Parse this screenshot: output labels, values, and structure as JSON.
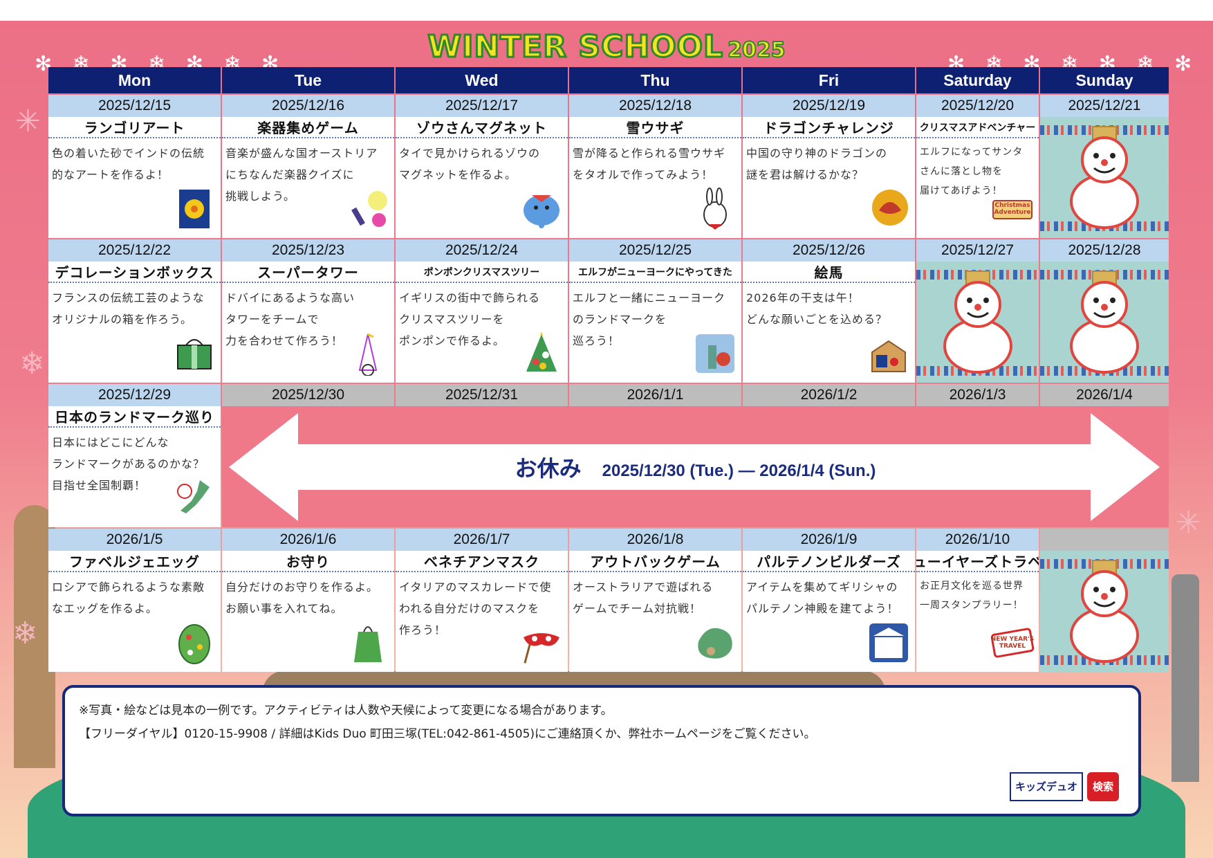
{
  "title": {
    "main": "WINTER SCHOOL",
    "year": "2025"
  },
  "weekdays": [
    "Mon",
    "Tue",
    "Wed",
    "Thu",
    "Fri",
    "Saturday",
    "Sunday"
  ],
  "weeks": [
    {
      "days": [
        {
          "date": "2025/12/15",
          "activity": "ランゴリアート",
          "desc_lines": [
            "色の着いた砂でインドの伝統",
            "的なアートを作るよ！"
          ],
          "icon": "rangoli-art-icon"
        },
        {
          "date": "2025/12/16",
          "activity": "楽器集めゲーム",
          "desc_lines": [
            "音楽が盛んな国オーストリア",
            "にちなんだ楽器クイズに",
            "挑戦しよう。"
          ],
          "icon": "instruments-icon"
        },
        {
          "date": "2025/12/17",
          "activity": "ゾウさんマグネット",
          "desc_lines": [
            "タイで見かけられるゾウの",
            "マグネットを作るよ。"
          ],
          "icon": "elephant-icon"
        },
        {
          "date": "2025/12/18",
          "activity": "雪ウサギ",
          "desc_lines": [
            "雪が降ると作られる雪ウサギ",
            "をタオルで作ってみよう！"
          ],
          "icon": "snow-rabbit-icon"
        },
        {
          "date": "2025/12/19",
          "activity": "ドラゴンチャレンジ",
          "desc_lines": [
            "中国の守り神のドラゴンの",
            "謎を君は解けるかな？"
          ],
          "icon": "dragon-icon"
        },
        {
          "date": "2025/12/20",
          "activity": "クリスマスアドベンチャー",
          "desc_lines": [
            "エルフになってサンタ",
            "さんに落とし物を",
            "届けてあげよう！"
          ],
          "icon": "christmas-adventure-icon",
          "badge": "Christmas Adventure"
        },
        {
          "date": "2025/12/21",
          "snowman": true
        }
      ]
    },
    {
      "days": [
        {
          "date": "2025/12/22",
          "activity": "デコレーションボックス",
          "desc_lines": [
            "フランスの伝統工芸のような",
            "オリジナルの箱を作ろう。"
          ],
          "icon": "gift-box-icon"
        },
        {
          "date": "2025/12/23",
          "activity": "スーパータワー",
          "desc_lines": [
            "ドバイにあるような高い",
            "タワーをチームで",
            "力を合わせて作ろう！"
          ],
          "icon": "tower-icon"
        },
        {
          "date": "2025/12/24",
          "activity": "ポンポンクリスマスツリー",
          "desc_lines": [
            "イギリスの街中で飾られる",
            "クリスマスツリーを",
            "ポンポンで作るよ。"
          ],
          "icon": "christmas-tree-icon"
        },
        {
          "date": "2025/12/25",
          "activity": "エルフがニューヨークにやってきた",
          "desc_lines": [
            "エルフと一緒にニューヨーク",
            "のランドマークを",
            "巡ろう！"
          ],
          "icon": "statue-of-liberty-icon"
        },
        {
          "date": "2025/12/26",
          "activity": "絵馬",
          "desc_lines": [
            "2026年の干支は午！",
            "どんな願いごとを込める？"
          ],
          "icon": "ema-icon"
        },
        {
          "date": "2025/12/27",
          "snowman": true
        },
        {
          "date": "2025/12/28",
          "snowman": true
        }
      ]
    },
    {
      "days": [
        {
          "date": "2025/12/29",
          "activity": "日本のランドマーク巡り",
          "desc_lines": [
            "日本にはどこにどんな",
            "ランドマークがあるのかな？",
            "目指せ全国制覇！"
          ],
          "icon": "japan-map-icon"
        }
      ],
      "holiday_dates": [
        "2025/12/30",
        "2025/12/31",
        "2026/1/1",
        "2026/1/2",
        "2026/1/3",
        "2026/1/4"
      ],
      "holiday": {
        "label": "お休み",
        "range": "2025/12/30 (Tue.) ― 2026/1/4 (Sun.)"
      }
    },
    {
      "days": [
        {
          "date": "2026/1/5",
          "activity": "ファベルジェエッグ",
          "desc_lines": [
            "ロシアで飾られるような素敵",
            "なエッグを作るよ。"
          ],
          "icon": "faberge-egg-icon"
        },
        {
          "date": "2026/1/6",
          "activity": "お守り",
          "desc_lines": [
            "自分だけのお守りを作るよ。",
            "お願い事を入れてね。"
          ],
          "icon": "omamori-icon"
        },
        {
          "date": "2026/1/7",
          "activity": "ベネチアンマスク",
          "desc_lines": [
            "イタリアのマスカレードで使",
            "われる自分だけのマスクを",
            "作ろう！"
          ],
          "icon": "venetian-mask-icon"
        },
        {
          "date": "2026/1/8",
          "activity": "アウトバックゲーム",
          "desc_lines": [
            "オーストラリアで遊ばれる",
            "ゲームでチーム対抗戦！"
          ],
          "icon": "australia-icon"
        },
        {
          "date": "2026/1/9",
          "activity": "パルテノンビルダーズ",
          "desc_lines": [
            "アイテムを集めてギリシャの",
            "パルテノン神殿を建てよう！"
          ],
          "icon": "parthenon-icon"
        },
        {
          "date": "2026/1/10",
          "activity": "ニューイヤーズトラベル",
          "desc_lines": [
            "お正月文化を巡る世界",
            "一周スタンプラリー！"
          ],
          "icon": "new-year-travel-stamp-icon",
          "badge": "NEW YEAR'S TRAVEL"
        },
        {
          "date": "",
          "snowman": true
        }
      ]
    }
  ],
  "notes": {
    "line1": "※写真・絵などは見本の一例です。アクティビティは人数や天候によって変更になる場合があります。",
    "line2": "【フリーダイヤル】0120-15-9908 / 詳細はKids Duo 町田三塚(TEL:042-861-4505)にご連絡頂くか、弊社ホームページをご覧ください。",
    "search_keyword": "キッズデュオ",
    "search_button": "検索"
  },
  "colors": {
    "header_bg": "#0d2072",
    "date_bg": "#bcd6ef",
    "holiday_date_bg": "#bdbdbd",
    "holiday_bg": "#ef7889",
    "snow_cell_bg": "#a9d4cf",
    "title_yellow": "#f4e322",
    "title_green": "#2b8a2b"
  }
}
